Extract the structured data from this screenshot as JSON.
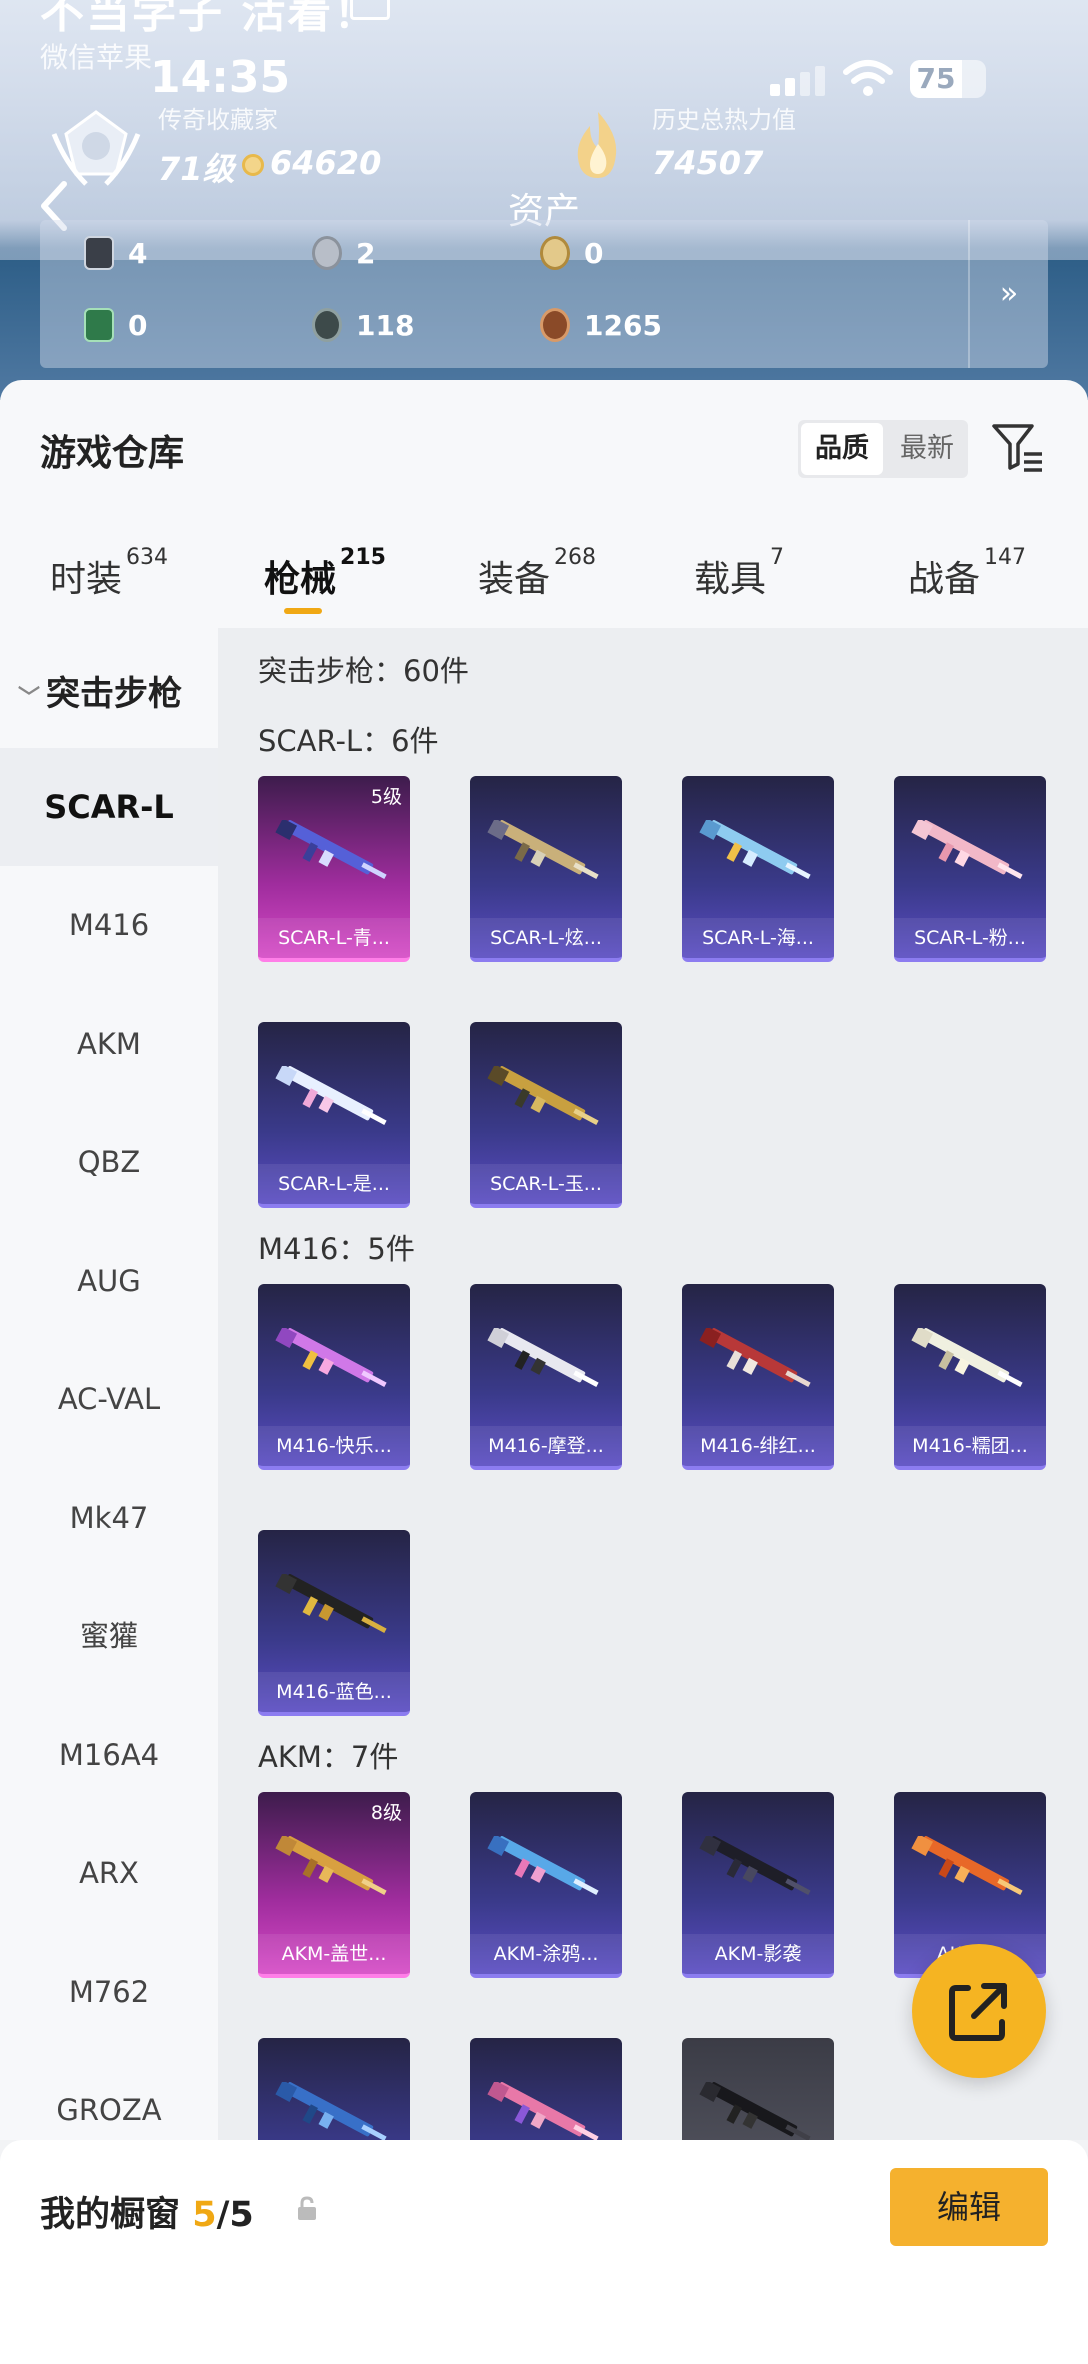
{
  "status_bar": {
    "time": "14:35",
    "battery": "75"
  },
  "profile": {
    "name": "不当学子 活着！",
    "subtitle": "微信苹果",
    "rank_title": "传奇收藏家",
    "level": "71级",
    "coins": "64620",
    "history_label": "历史总热力值",
    "history_value": "74507",
    "question": "?"
  },
  "header": {
    "title": "资产"
  },
  "stats": {
    "items": [
      {
        "value": "4",
        "icon": "card-icon"
      },
      {
        "value": "2",
        "icon": "silver-coin-icon"
      },
      {
        "value": "0",
        "icon": "gold-badge-icon"
      },
      {
        "value": "0",
        "icon": "green-card-icon"
      },
      {
        "value": "118",
        "icon": "dark-coin-icon"
      },
      {
        "value": "1265",
        "icon": "bronze-coin-icon"
      }
    ],
    "more": "»"
  },
  "warehouse": {
    "title": "游戏仓库",
    "sort_options": [
      "品质",
      "最新"
    ],
    "tabs": [
      {
        "label": "时装",
        "count": "634"
      },
      {
        "label": "枪械",
        "count": "215"
      },
      {
        "label": "装备",
        "count": "268"
      },
      {
        "label": "载具",
        "count": "7"
      },
      {
        "label": "战备",
        "count": "147"
      }
    ]
  },
  "sidebar": {
    "category": "突击步枪",
    "items": [
      "SCAR-L",
      "M416",
      "AKM",
      "QBZ",
      "AUG",
      "AC-VAL",
      "Mk47",
      "蜜獾",
      "M16A4",
      "ARX",
      "M762",
      "GROZA"
    ]
  },
  "content": {
    "total": "突击步枪：60件",
    "groups": [
      {
        "title": "SCAR-L：6件",
        "cards": [
          {
            "name": "SCAR-L-青...",
            "level": "5级"
          },
          {
            "name": "SCAR-L-炫...",
            "level": ""
          },
          {
            "name": "SCAR-L-海...",
            "level": ""
          },
          {
            "name": "SCAR-L-粉...",
            "level": ""
          },
          {
            "name": "SCAR-L-是...",
            "level": ""
          },
          {
            "name": "SCAR-L-玉...",
            "level": ""
          }
        ]
      },
      {
        "title": "M416：5件",
        "cards": [
          {
            "name": "M416-快乐...",
            "level": ""
          },
          {
            "name": "M416-摩登...",
            "level": ""
          },
          {
            "name": "M416-绯红...",
            "level": ""
          },
          {
            "name": "M416-糯团...",
            "level": ""
          },
          {
            "name": "M416-蓝色...",
            "level": ""
          }
        ]
      },
      {
        "title": "AKM：7件",
        "cards": [
          {
            "name": "AKM-盖世...",
            "level": "8级"
          },
          {
            "name": "AKM-涂鸦...",
            "level": ""
          },
          {
            "name": "AKM-影袭",
            "level": ""
          },
          {
            "name": "AKM-...",
            "level": ""
          },
          {
            "name": "",
            "level": ""
          },
          {
            "name": "",
            "level": ""
          },
          {
            "name": "",
            "level": ""
          }
        ]
      }
    ]
  },
  "showcase": {
    "label": "我的橱窗",
    "current": "5",
    "sep_total": "/5",
    "edit": "编辑"
  },
  "colors": {
    "accent": "#f0a814",
    "card_purple": "#3a3a8a",
    "card_pink": "#a02d9e"
  }
}
